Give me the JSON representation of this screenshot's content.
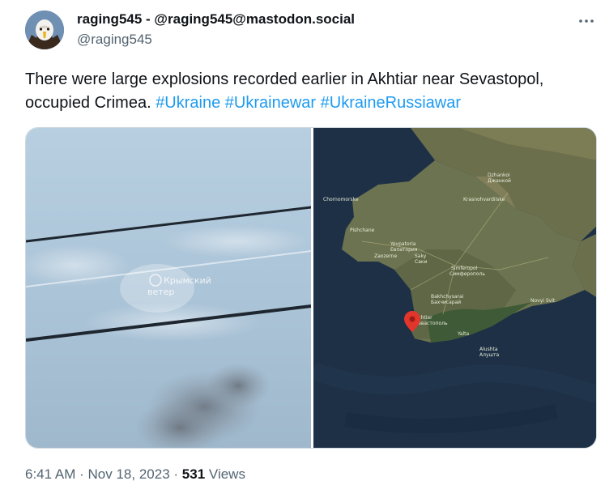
{
  "post": {
    "display_name": "raging545 - @raging545@mastodon.social",
    "handle": "@raging545",
    "text": "There were large explosions recorded earlier in  Akhtiar near Sevastopol, occupied Crimea.",
    "hashtags": [
      "#Ukraine",
      "#Ukrainewar",
      "#UkraineRussiawar"
    ],
    "time": "6:41 AM",
    "separator": "·",
    "date": "Nov 18, 2023",
    "views_count": "531",
    "views_label": "Views"
  },
  "media": {
    "left_watermark": [
      "Крымский",
      "ветер"
    ],
    "map_labels": {
      "evpatoria": "Yevpatoria",
      "evpatoria_ru": "Евпатория",
      "simferopol": "Simferopol",
      "simferopol_ru": "Симферополь",
      "bakhchysarai": "Bakhchysarai",
      "bakhchysarai_ru": "Бахчисарай",
      "sevastopol": "Akhtiar",
      "sevastopol_ru": "Севастополь",
      "yalta": "Yalta",
      "alushta": "Alushta",
      "alushta_ru": "Алушта",
      "dzhankoi": "Dzhankoi",
      "dzhankoi_ru": "Джанкой",
      "chornomorske": "Chornomorske",
      "saky": "Saky",
      "saky_ru": "Саки",
      "novyi_svit": "Novyi Svit",
      "krasnohvardiiske": "Krasnohvardiiske",
      "zaozerne": "Zaozerne",
      "pishchane": "Pishchane"
    },
    "colors": {
      "sky": "#a9c2d6",
      "sea": "#1d3046",
      "land": "#6c7350",
      "pin": "#e0362c"
    }
  }
}
